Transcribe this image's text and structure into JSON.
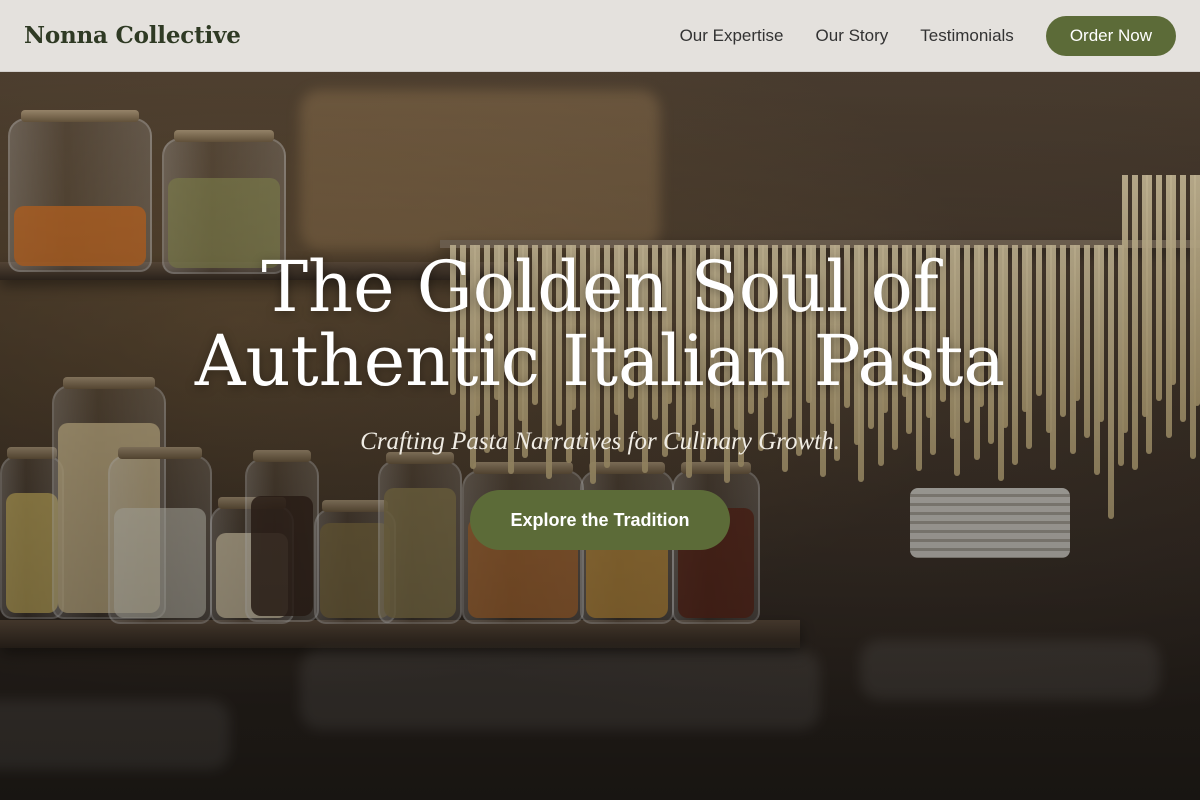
{
  "header": {
    "brand": "Nonna Collective",
    "nav": [
      {
        "label": "Our Expertise"
      },
      {
        "label": "Our Story"
      },
      {
        "label": "Testimonials"
      }
    ],
    "cta": "Order Now"
  },
  "hero": {
    "headline_line1": "The Golden Soul of",
    "headline_line2": "Authentic Italian Pasta",
    "subheadline": "Crafting Pasta Narratives for Culinary Growth.",
    "cta": "Explore the Tradition",
    "background_image": "kitchen-pantry-photo"
  },
  "colors": {
    "accent": "#5c6b38",
    "header_bg": "#f0eeeb",
    "brand_text": "#2f3a24"
  }
}
